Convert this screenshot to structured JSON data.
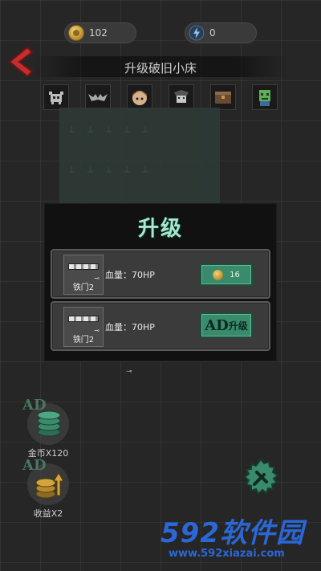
{
  "currency": {
    "coins": "102",
    "energy": "0"
  },
  "header": {
    "title": "升级破旧小床"
  },
  "icons_row": [
    "monster-icon",
    "bat-icon",
    "character-face-icon",
    "vampire-icon",
    "chest-icon",
    "zombie-icon"
  ],
  "modal": {
    "title": "升级",
    "cards": [
      {
        "item_name": "铁门2",
        "hp_text": "血量：70HP",
        "button_value": "16"
      },
      {
        "item_name": "铁门2",
        "hp_text": "血量：70HP",
        "button_ad": "AD",
        "button_label": "升级"
      }
    ]
  },
  "bonuses": [
    {
      "ad": "AD",
      "label": "金币X120"
    },
    {
      "ad": "AD",
      "label": "收益X2"
    }
  ],
  "watermark": {
    "main": "592软件园",
    "url": "www.592xiazai.com"
  },
  "colors": {
    "accent_green": "#3a8a6c",
    "title_mint": "#a7e9cf",
    "watermark_blue": "#2b67d6"
  }
}
